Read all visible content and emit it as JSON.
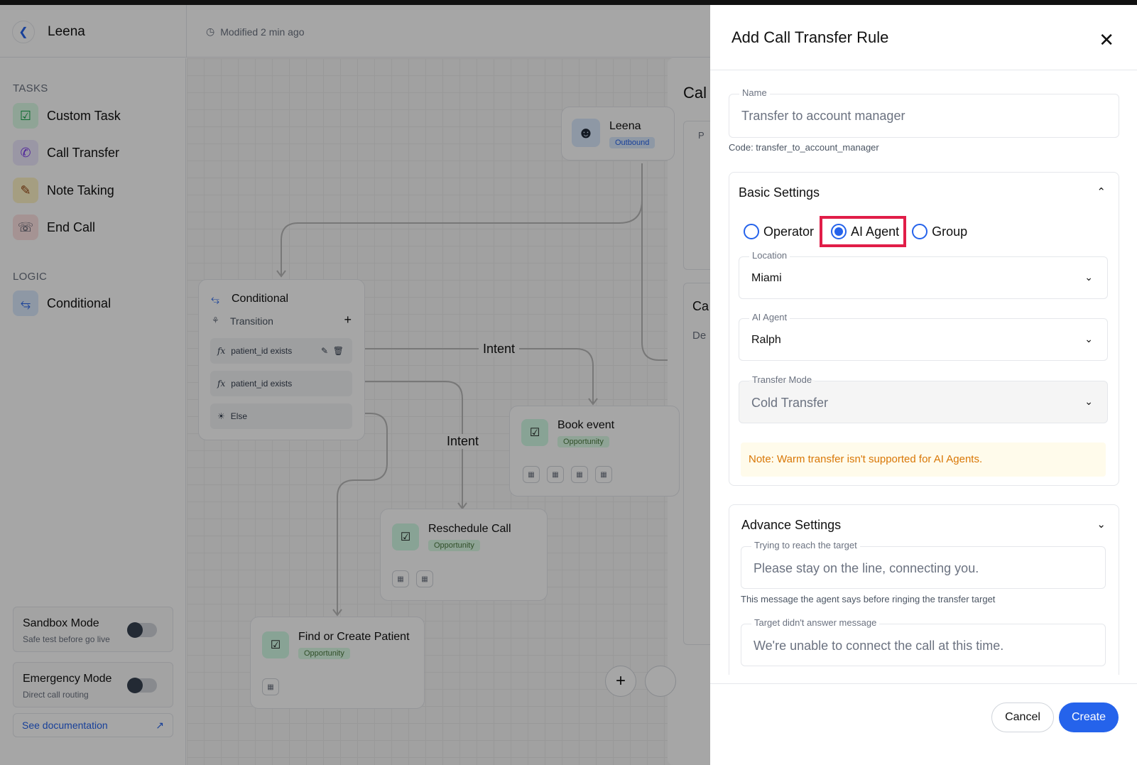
{
  "header": {
    "back_icon": "chevron-left-icon",
    "agent_name": "Leena",
    "modified": "Modified 2 min ago"
  },
  "sidebar": {
    "tasks_label": "TASKS",
    "tasks": [
      {
        "label": "Custom Task",
        "icon": "checkbox-icon"
      },
      {
        "label": "Call Transfer",
        "icon": "phone-transfer-icon"
      },
      {
        "label": "Note Taking",
        "icon": "note-icon"
      },
      {
        "label": "End Call",
        "icon": "end-call-icon"
      }
    ],
    "logic_label": "LOGIC",
    "logic": [
      {
        "label": "Conditional",
        "icon": "branch-icon"
      }
    ],
    "sandbox": {
      "title": "Sandbox Mode",
      "subtitle": "Safe test before go live"
    },
    "emergency": {
      "title": "Emergency Mode",
      "subtitle": "Direct call routing"
    },
    "docs_link": "See documentation"
  },
  "canvas": {
    "agent_node": {
      "name": "Leena",
      "badge": "Outbound"
    },
    "conditional": {
      "title": "Conditional",
      "transition": "Transition",
      "rows": [
        "patient_id exists",
        "patient_id exists",
        "Else"
      ]
    },
    "intent_1": "Intent",
    "intent_2": "Intent",
    "book_event": {
      "title": "Book event",
      "badge": "Opportunity"
    },
    "reschedule": {
      "title": "Reschedule Call",
      "badge": "Opportunity"
    },
    "find_patient": {
      "title": "Find or Create Patient",
      "badge": "Opportunity"
    },
    "bg_fragments": {
      "cal": "Cal",
      "p": "P",
      "ca": "Ca",
      "de": "De"
    }
  },
  "drawer": {
    "title": "Add Call Transfer Rule",
    "name_field": {
      "label": "Name",
      "placeholder": "Transfer to account manager"
    },
    "code": "Code: transfer_to_account_manager",
    "basic_settings": {
      "title": "Basic Settings",
      "options": [
        "Operator",
        "AI Agent",
        "Group"
      ],
      "selected": "AI Agent",
      "location": {
        "label": "Location",
        "value": "Miami"
      },
      "ai_agent": {
        "label": "AI Agent",
        "value": "Ralph"
      },
      "transfer_mode": {
        "label": "Transfer Mode",
        "value": "Cold Transfer"
      },
      "note": "Note: Warm transfer isn't supported for AI Agents."
    },
    "advance_settings": {
      "title": "Advance Settings",
      "reach_target": {
        "label": "Trying to reach the target",
        "value": "Please stay on the line, connecting you."
      },
      "reach_help": "This message the agent says before ringing the transfer target",
      "no_answer": {
        "label": "Target didn't answer message",
        "value": "We're unable to connect the call at this time."
      }
    },
    "cancel": "Cancel",
    "create": "Create"
  },
  "colors": {
    "accent": "#2563eb",
    "highlight": "#e11d48",
    "note_text": "#d97706",
    "note_bg": "#fffbeb"
  }
}
